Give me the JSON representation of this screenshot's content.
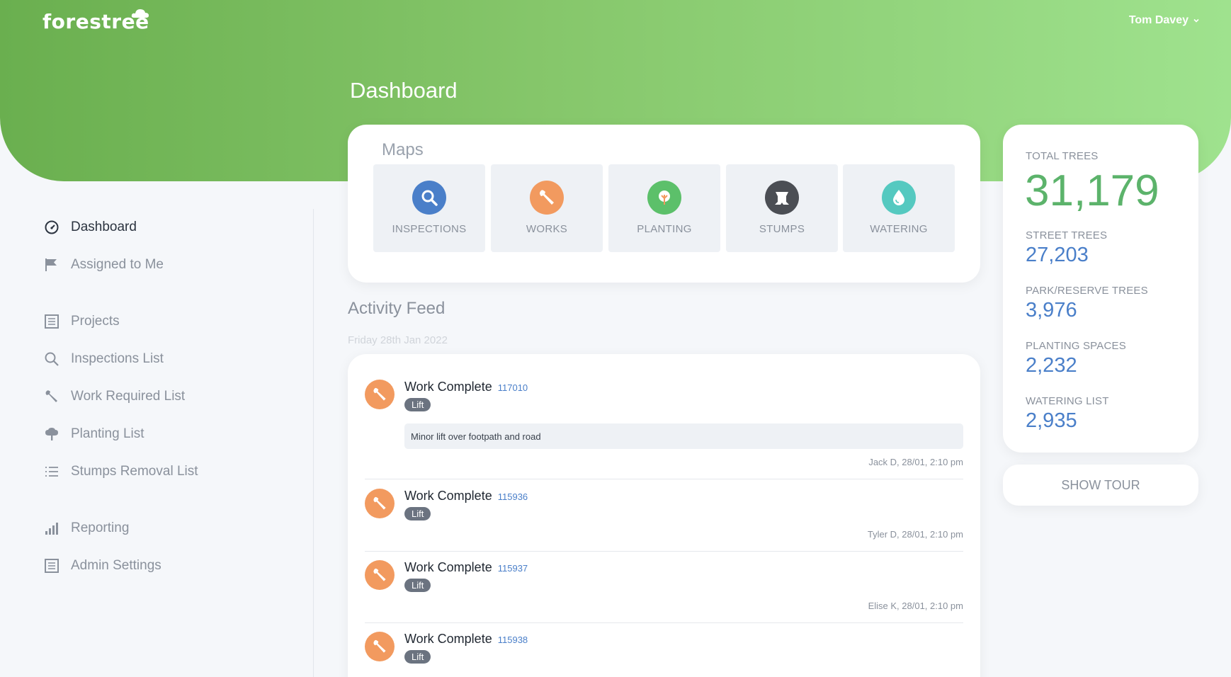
{
  "app": {
    "logo": "forestree",
    "user": "Tom Davey"
  },
  "page": {
    "title": "Dashboard"
  },
  "sidebar": {
    "items": [
      {
        "label": "Dashboard",
        "icon": "dashboard-gauge-icon"
      },
      {
        "label": "Assigned to Me",
        "icon": "flag-icon"
      },
      {
        "label": "Projects",
        "icon": "list-box-icon"
      },
      {
        "label": "Inspections List",
        "icon": "search-icon"
      },
      {
        "label": "Work Required List",
        "icon": "wrench-icon"
      },
      {
        "label": "Planting List",
        "icon": "tree-icon"
      },
      {
        "label": "Stumps Removal List",
        "icon": "list-icon"
      },
      {
        "label": "Reporting",
        "icon": "bar-chart-icon"
      },
      {
        "label": "Admin Settings",
        "icon": "list-box-icon"
      }
    ]
  },
  "maps": {
    "title": "Maps",
    "tiles": [
      {
        "label": "INSPECTIONS",
        "color": "#4a7fc9",
        "icon": "search-icon"
      },
      {
        "label": "WORKS",
        "color": "#f29a5f",
        "icon": "wrench-icon"
      },
      {
        "label": "PLANTING",
        "color": "#5cc06a",
        "icon": "tree-icon"
      },
      {
        "label": "STUMPS",
        "color": "#4b4e54",
        "icon": "stump-icon"
      },
      {
        "label": "WATERING",
        "color": "#55c9c0",
        "icon": "water-drop-icon"
      }
    ]
  },
  "feed": {
    "title": "Activity Feed",
    "date": "Friday 28th Jan 2022",
    "items": [
      {
        "title": "Work Complete",
        "id": "117010",
        "badge": "Lift",
        "note": "Minor lift over footpath and road",
        "meta": "Jack D, 28/01, 2:10 pm"
      },
      {
        "title": "Work Complete",
        "id": "115936",
        "badge": "Lift",
        "note": "",
        "meta": "Tyler D, 28/01, 2:10 pm"
      },
      {
        "title": "Work Complete",
        "id": "115937",
        "badge": "Lift",
        "note": "",
        "meta": "Elise K, 28/01, 2:10 pm"
      },
      {
        "title": "Work Complete",
        "id": "115938",
        "badge": "Lift",
        "note": "",
        "meta": ""
      }
    ]
  },
  "stats": {
    "total_label": "TOTAL TREES",
    "total_value": "31,179",
    "rows": [
      {
        "label": "STREET TREES",
        "value": "27,203"
      },
      {
        "label": "PARK/RESERVE TREES",
        "value": "3,976"
      },
      {
        "label": "PLANTING SPACES",
        "value": "2,232"
      },
      {
        "label": "WATERING LIST",
        "value": "2,935"
      }
    ]
  },
  "tour": {
    "label": "SHOW TOUR"
  },
  "colors": {
    "brand_green": "#6aaf4f",
    "accent_blue": "#4a7fc9",
    "works_orange": "#f29a5f"
  }
}
